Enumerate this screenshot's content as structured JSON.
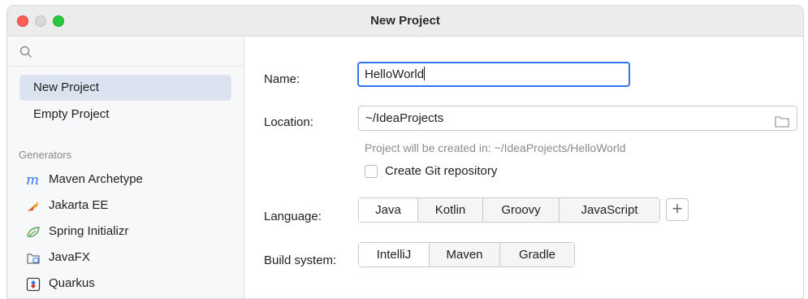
{
  "window": {
    "title": "New Project"
  },
  "search": {
    "placeholder": ""
  },
  "sidebar": {
    "project_types": [
      {
        "label": "New Project",
        "active": true
      },
      {
        "label": "Empty Project",
        "active": false
      }
    ],
    "generators_label": "Generators",
    "generators": [
      {
        "label": "Maven Archetype",
        "icon": "maven-icon"
      },
      {
        "label": "Jakarta EE",
        "icon": "jakarta-ee-icon"
      },
      {
        "label": "Spring Initializr",
        "icon": "spring-icon"
      },
      {
        "label": "JavaFX",
        "icon": "javafx-icon"
      },
      {
        "label": "Quarkus",
        "icon": "quarkus-icon"
      }
    ]
  },
  "form": {
    "name_label": "Name:",
    "name_value": "HelloWorld",
    "location_label": "Location:",
    "location_value": "~/IdeaProjects",
    "location_hint": "Project will be created in: ~/IdeaProjects/HelloWorld",
    "git_checkbox_label": "Create Git repository",
    "git_checked": false,
    "language_label": "Language:",
    "languages": [
      "Java",
      "Kotlin",
      "Groovy",
      "JavaScript"
    ],
    "selected_language": "Java",
    "add_language_label": "+",
    "build_label": "Build system:",
    "build_systems": [
      "IntelliJ",
      "Maven",
      "Gradle"
    ],
    "selected_build": "IntelliJ"
  },
  "colors": {
    "accent": "#3574f0",
    "selection": "#dce3f0",
    "close": "#fe5f57",
    "zoom": "#28c840"
  }
}
